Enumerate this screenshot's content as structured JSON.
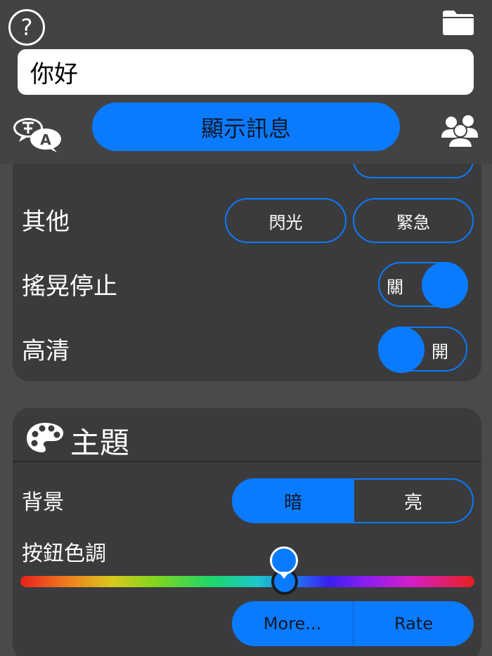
{
  "header": {
    "help_label": "?",
    "message_value": "你好",
    "show_button_label": "顯示訊息"
  },
  "settings": {
    "other_label": "其他",
    "flash_label": "閃光",
    "emergency_label": "緊急",
    "shake_stop_label": "搖晃停止",
    "shake_stop_state": "關",
    "hd_label": "高清",
    "hd_state": "開"
  },
  "theme": {
    "title": "主題",
    "background_label": "背景",
    "dark_label": "暗",
    "light_label": "亮",
    "button_hue_label": "按鈕色調",
    "hue_position": 0.58
  },
  "footer": {
    "more_label": "More...",
    "rate_label": "Rate"
  },
  "colors": {
    "accent": "#0a7bff",
    "card": "#3b3b3d",
    "header": "#434345",
    "background": "#4a4a4c"
  },
  "icons": {
    "help": "help-icon",
    "folder": "folder-icon",
    "translate": "translate-icon",
    "people": "people-icon",
    "palette": "palette-icon"
  }
}
